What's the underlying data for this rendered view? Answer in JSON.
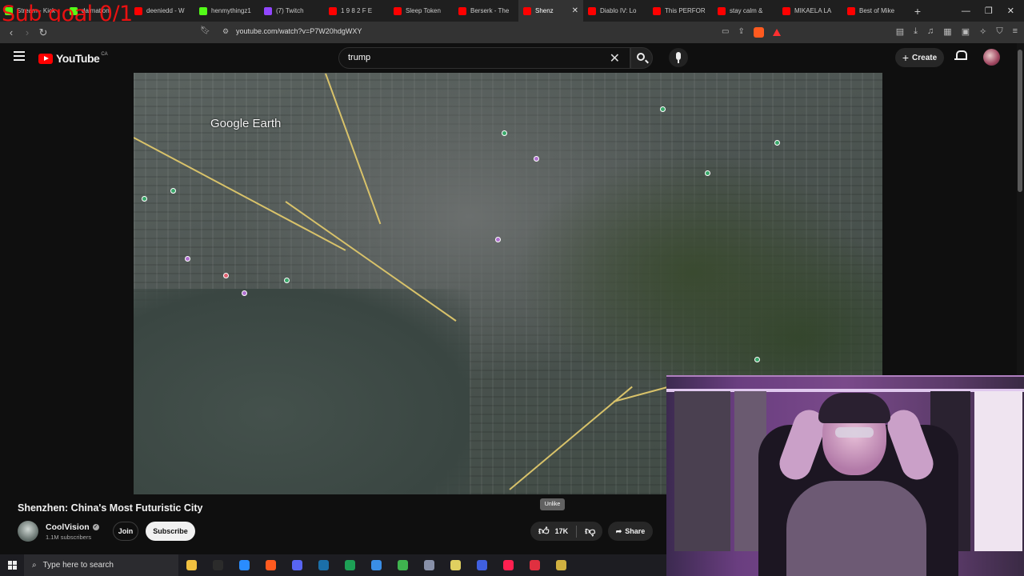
{
  "overlay": {
    "text": "Sub goal 0/1"
  },
  "browser": {
    "tabs": [
      {
        "label": "Stream - Kick",
        "color": "#53fc18"
      },
      {
        "label": "dalmation",
        "color": "#53fc18"
      },
      {
        "label": "deeniedd - W",
        "color": "#ff0000"
      },
      {
        "label": "henmythingz1",
        "color": "#53fc18"
      },
      {
        "label": "(7) Twitch",
        "color": "#9146ff"
      },
      {
        "label": "1 9 8 2 F E",
        "color": "#ff0000"
      },
      {
        "label": "Sleep Token",
        "color": "#ff0000"
      },
      {
        "label": "Berserk - The",
        "color": "#ff0000"
      },
      {
        "label": "Shenz",
        "color": "#ff0000",
        "active": true
      },
      {
        "label": "Diablo IV: Lo",
        "color": "#ff0000"
      },
      {
        "label": "This PERFOR",
        "color": "#ff0000"
      },
      {
        "label": "stay calm &",
        "color": "#ff0000"
      },
      {
        "label": "MIKAELA LA",
        "color": "#ff0000"
      },
      {
        "label": "Best of Mike",
        "color": "#ff0000"
      }
    ],
    "new_tab": "+",
    "url": "youtube.com/watch?v=P7W20hdgWXY",
    "window_controls": [
      "—",
      "❐",
      "✕"
    ]
  },
  "youtube": {
    "logo_text": "YouTube",
    "region": "CA",
    "search_query": "trump",
    "create_label": "Create"
  },
  "video": {
    "watermark": "Google Earth",
    "title": "Shenzhen: China's Most Futuristic City",
    "channel": "CoolVision",
    "subscribers": "1.1M subscribers",
    "join_label": "Join",
    "subscribe_label": "Subscribe",
    "tooltip": "Unlike",
    "likes": "17K",
    "share_label": "Share"
  },
  "taskbar": {
    "search_placeholder": "Type here to search",
    "apps": [
      {
        "name": "file-explorer-icon",
        "color": "#f0c040"
      },
      {
        "name": "epic-games-icon",
        "color": "#2b2b2b"
      },
      {
        "name": "obs-icon",
        "color": "#2a8cff"
      },
      {
        "name": "brave-icon",
        "color": "#ff5a1f"
      },
      {
        "name": "discord-icon",
        "color": "#5865f2"
      },
      {
        "name": "steam-icon",
        "color": "#1b6fa8"
      },
      {
        "name": "excel-icon",
        "color": "#1d9f55"
      },
      {
        "name": "notepad-icon",
        "color": "#3a8ee6"
      },
      {
        "name": "xbox-icon",
        "color": "#3fb34f"
      },
      {
        "name": "shield-app-icon",
        "color": "#8890a8"
      },
      {
        "name": "file-icon",
        "color": "#e0d060"
      },
      {
        "name": "chat-app-icon",
        "color": "#4060e0"
      },
      {
        "name": "tiktok-icon",
        "color": "#ff2050"
      },
      {
        "name": "media-app-icon",
        "color": "#e03040"
      },
      {
        "name": "notes-icon",
        "color": "#d0b040"
      }
    ]
  }
}
